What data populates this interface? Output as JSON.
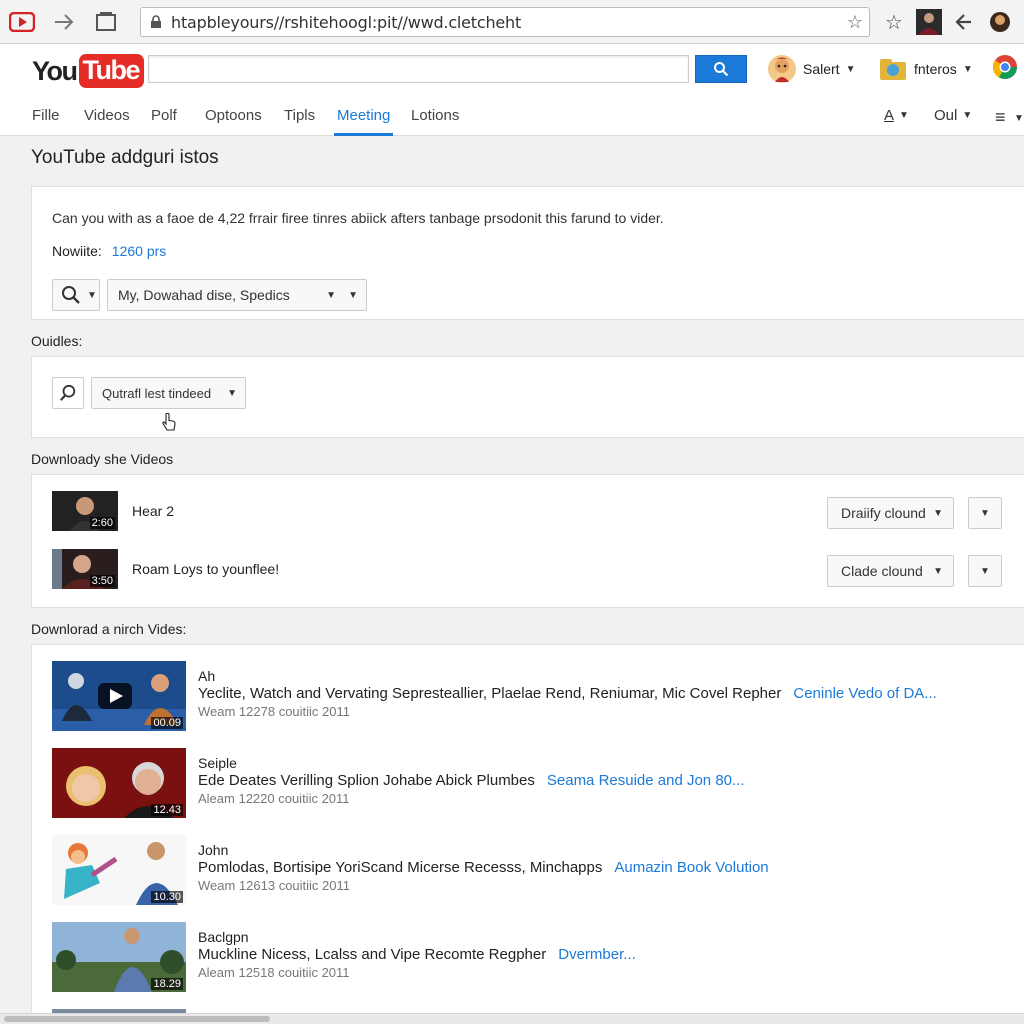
{
  "browser": {
    "url": "htapbleyours//rshitehoogl:pit//wwd.cletcheht",
    "icons": [
      "browser-logo-icon",
      "forward-icon",
      "window-icon",
      "lock-icon",
      "bookmark-star-icon",
      "extension-star-icon",
      "profile-photo-icon",
      "tool-icon",
      "extension-avatar-icon"
    ]
  },
  "header": {
    "logo_you": "You",
    "logo_tube": "Tube",
    "search_placeholder": "",
    "account1": "Salert",
    "account2": "fnteros",
    "accent": "#1b7ad8",
    "brand": "#e52d27"
  },
  "menu": {
    "tabs": [
      "Fille",
      "Videos",
      "Polf",
      "Optoons",
      "Tipls",
      "Meeting",
      "Lotions"
    ],
    "active_tab": "Meeting",
    "right1": "A",
    "right2": "Oul"
  },
  "main": {
    "title": "YouTube addguri istos",
    "info_text": "Can you with as a faoe de 4,22 frrair firee tinres abiick afters tanbage prsodonit this farund to vider.",
    "nowite_label": "Nowiite:",
    "nowite_value": "1260 prs",
    "format_select": "My, Dowahad dise, Spedics",
    "oudles_label": "Ouidles:",
    "quality_select": "Qutrafl lest tindeed",
    "download_label": "Downloady she Videos",
    "download_items": [
      {
        "title": "Hear 2",
        "duration": "2:60",
        "action": "Draiify clound"
      },
      {
        "title": "Roam Loys to younflee!",
        "duration": "3:50",
        "action": "Clade clound"
      }
    ],
    "list_label": "Downlorad a nirch Vides:",
    "videos": [
      {
        "name": "Ah",
        "description": "Yeclite, Watch and Vervating Sepresteallier, Plaelae Rend, Reniumar, Mic Covel Repher",
        "link": "Ceninle Vedo of DA...",
        "meta": "Weam 12278 couitiic 2011",
        "duration": "00.09"
      },
      {
        "name": "Seiple",
        "description": "Ede Deates Verilling Splion Johabe Abick Plumbes",
        "link": "Seama Resuide and Jon 80...",
        "meta": "Aleam 12220 couitiic 2011",
        "duration": "12.43"
      },
      {
        "name": "John",
        "description": "Pomlodas, Bortisipe YoriScand Micerse Recesss, Minchapps",
        "link": "Aumazin Book Volution",
        "meta": "Weam 12613 couitiic 2011",
        "duration": "10.30"
      },
      {
        "name": "Baclgpn",
        "description": "Muckline Nicess, Lcalss and Vipe Recomte Regpher",
        "link": "Dvermber...",
        "meta": "Aleam 12518 couitiic 2011",
        "duration": "18.29"
      }
    ]
  }
}
